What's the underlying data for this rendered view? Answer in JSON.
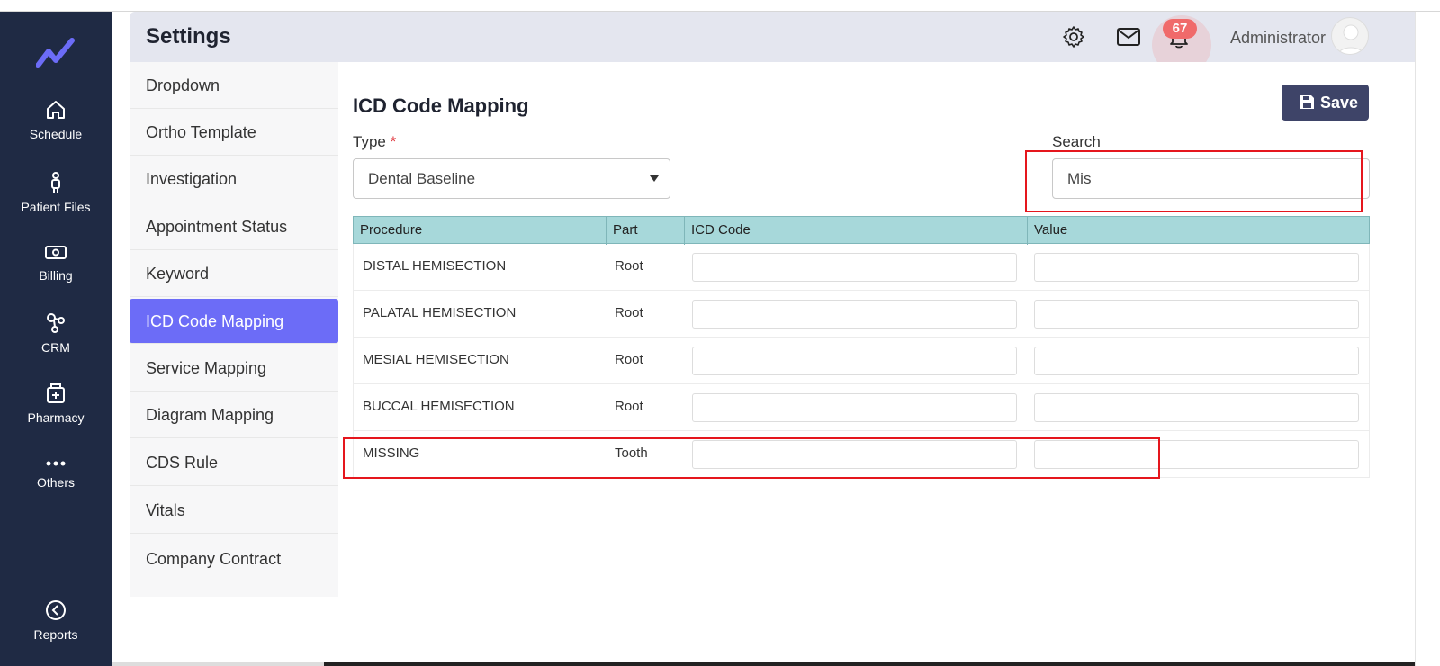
{
  "rail": {
    "items": [
      {
        "label": "Schedule",
        "icon": "home-icon"
      },
      {
        "label": "Patient Files",
        "icon": "patient-icon"
      },
      {
        "label": "Billing",
        "icon": "billing-icon"
      },
      {
        "label": "CRM",
        "icon": "crm-icon"
      },
      {
        "label": "Pharmacy",
        "icon": "pharmacy-icon"
      },
      {
        "label": "Others",
        "icon": "more-icon"
      },
      {
        "label": "Reports",
        "icon": "reports-icon"
      }
    ]
  },
  "header": {
    "title": "Settings",
    "notification_count": "67",
    "user_name": "Administrator"
  },
  "submenu": {
    "items": [
      {
        "label": "Dropdown"
      },
      {
        "label": "Ortho Template"
      },
      {
        "label": "Investigation"
      },
      {
        "label": "Appointment Status"
      },
      {
        "label": "Keyword"
      },
      {
        "label": "ICD Code Mapping"
      },
      {
        "label": "Service Mapping"
      },
      {
        "label": "Diagram Mapping"
      },
      {
        "label": "CDS Rule"
      },
      {
        "label": "Vitals"
      },
      {
        "label": "Company Contract"
      }
    ],
    "active": "ICD Code Mapping"
  },
  "main": {
    "title": "ICD Code Mapping",
    "save_label": "Save",
    "type_label": "Type",
    "required_mark": "*",
    "type_value": "Dental Baseline",
    "search_label": "Search",
    "search_value": "Mis"
  },
  "table": {
    "columns": [
      "Procedure",
      "Part",
      "ICD Code",
      "Value"
    ],
    "rows": [
      {
        "procedure": "DISTAL HEMISECTION",
        "part": "Root",
        "icd_code": "",
        "value": ""
      },
      {
        "procedure": "PALATAL HEMISECTION",
        "part": "Root",
        "icd_code": "",
        "value": ""
      },
      {
        "procedure": "MESIAL HEMISECTION",
        "part": "Root",
        "icd_code": "",
        "value": ""
      },
      {
        "procedure": "BUCCAL HEMISECTION",
        "part": "Root",
        "icd_code": "",
        "value": ""
      },
      {
        "procedure": "MISSING",
        "part": "Tooth",
        "icd_code": "",
        "value": ""
      }
    ]
  },
  "colors": {
    "rail_bg": "#1f2a44",
    "active_menu": "#6c6cf7",
    "table_header": "#a7d8da",
    "save_button": "#3e4468",
    "highlight": "#e5161d"
  }
}
